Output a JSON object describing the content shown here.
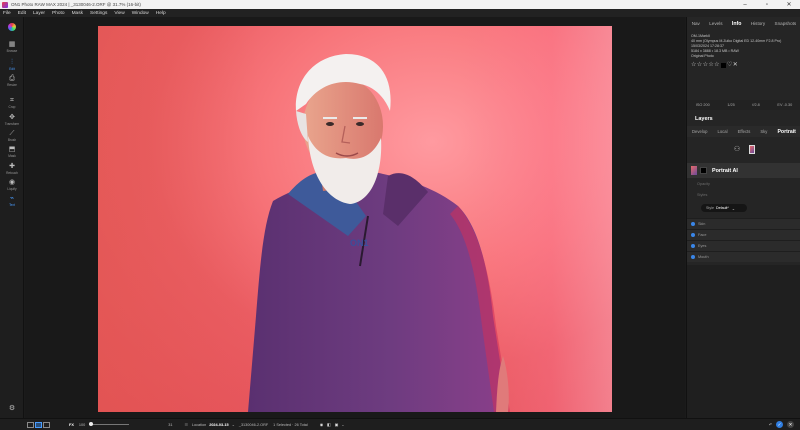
{
  "window": {
    "title": "ON1 Photo RAW MAX 2024 | _3130046-2.ORF @ 31.7% (16-bit)",
    "minimize": "–",
    "maximize": "▫",
    "close": "✕"
  },
  "menu": [
    "File",
    "Edit",
    "Layer",
    "Photo",
    "Mask",
    "Settings",
    "View",
    "Window",
    "Help"
  ],
  "tools": [
    {
      "label": "Browse",
      "icon": "grid-icon",
      "glyph": "▦"
    },
    {
      "label": "Edit",
      "icon": "sliders-icon",
      "glyph": "⫶",
      "active": true
    },
    {
      "label": "Resize",
      "icon": "printer-icon",
      "glyph": "⎙"
    },
    {
      "label": "Crop",
      "icon": "crop-icon",
      "glyph": "⌗"
    },
    {
      "label": "Transform",
      "icon": "move-icon",
      "glyph": "✥"
    },
    {
      "label": "Brush",
      "icon": "brush-icon",
      "glyph": "⟋"
    },
    {
      "label": "Mask",
      "icon": "mask-icon",
      "glyph": "⬒"
    },
    {
      "label": "Retouch",
      "icon": "bandage-icon",
      "glyph": "✚"
    },
    {
      "label": "Liquify",
      "icon": "liquify-icon",
      "glyph": "◉"
    },
    {
      "label": "Text",
      "icon": "text-icon",
      "glyph": "⌁"
    }
  ],
  "right_tabs": [
    "Nav",
    "Levels",
    "Info",
    "History",
    "Snapshots"
  ],
  "right_active_tab": "Info",
  "info": {
    "camera": "OM-1MarkII",
    "lens": "40 mm (Olympus M.Zuiko Digital ED 12-40mm F2.8 Pro)",
    "datetime": "15/03/2024 17:28:37",
    "dimensions": "5184 x 3888 • 18.3 MB • RAW",
    "original": "Original Photo"
  },
  "exif": {
    "iso": "ISO 200",
    "shutter": "1/25",
    "aperture": "f/2.8",
    "ev": "EV -0.30"
  },
  "layers": {
    "title": "Layers",
    "subtabs": [
      "Develop",
      "Local",
      "Effects",
      "Sky",
      "Portrait"
    ],
    "active_subtab": "Portrait"
  },
  "portrait_ai": {
    "name": "Portrait AI",
    "sliders": [
      "Opacity",
      "Styles"
    ],
    "style_label": "Style",
    "style_value": "Default*",
    "sections": [
      "Skin",
      "Face",
      "Eyes",
      "Mouth"
    ]
  },
  "bottom": {
    "preview_label": "FX",
    "zoom_value": "100",
    "zoom_level": 0,
    "grid_count": "31",
    "location_label": "Location",
    "date": "2024-03-15",
    "filename": "_3130046-2.ORF",
    "selection": "1 Selected · 26 Total"
  },
  "colors": {
    "accent": "#4a9dff",
    "backdrop": "#ea5c62",
    "sweater": "#6a3a78"
  }
}
